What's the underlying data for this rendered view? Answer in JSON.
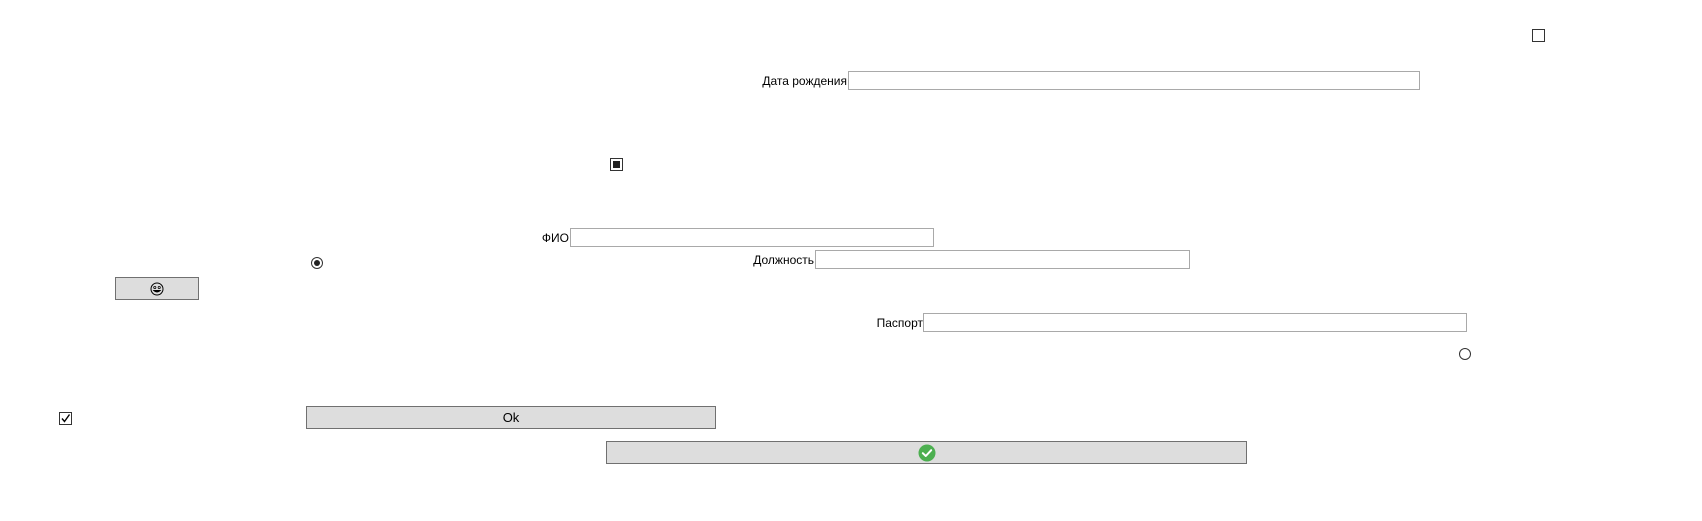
{
  "form": {
    "birth_date_label": "Дата рождения",
    "birth_date_value": "",
    "fio_label": "ФИО",
    "fio_value": "",
    "position_label": "Должность",
    "position_value": "",
    "passport_label": "Паспорт",
    "passport_value": ""
  },
  "controls": {
    "checkbox_top_right_checked": false,
    "checkbox_middle_state": "indeterminate",
    "checkbox_bottom_left_checked": true,
    "radio_left_selected": true,
    "radio_right_selected": false
  },
  "buttons": {
    "ok_label": "Ok",
    "emoji_icon": "face-emoji-icon",
    "confirm_icon": "green-check-circle-icon",
    "confirm_icon_color": "#4caf50"
  }
}
